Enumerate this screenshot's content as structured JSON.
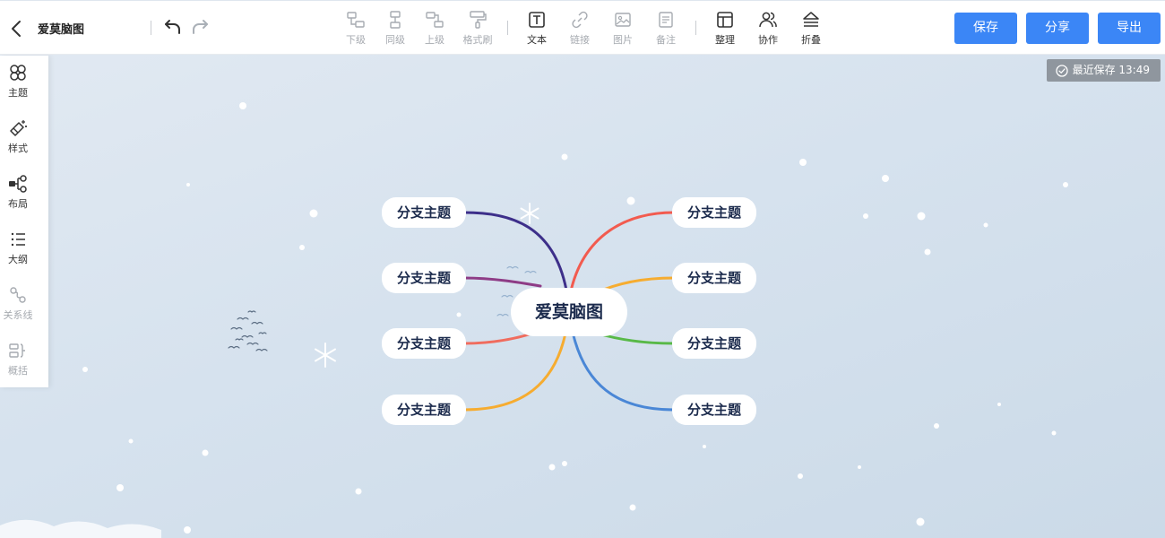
{
  "header": {
    "back_icon": "chevron-left-icon",
    "title": "爱莫脑图",
    "undo_icon": "undo-icon",
    "redo_icon": "redo-icon"
  },
  "toolbar": {
    "tools": [
      {
        "id": "child",
        "label": "下级",
        "icon": "add-child-node-icon",
        "enabled": false
      },
      {
        "id": "sibling",
        "label": "同级",
        "icon": "add-sibling-node-icon",
        "enabled": false
      },
      {
        "id": "parent",
        "label": "上级",
        "icon": "add-parent-node-icon",
        "enabled": false
      },
      {
        "id": "format-brush",
        "label": "格式刷",
        "icon": "format-brush-icon",
        "enabled": false
      },
      {
        "id": "text",
        "label": "文本",
        "icon": "text-box-icon",
        "enabled": true
      },
      {
        "id": "link",
        "label": "链接",
        "icon": "link-icon",
        "enabled": false
      },
      {
        "id": "image",
        "label": "图片",
        "icon": "image-icon",
        "enabled": false
      },
      {
        "id": "note",
        "label": "备注",
        "icon": "note-icon",
        "enabled": false
      },
      {
        "id": "arrange",
        "label": "整理",
        "icon": "layout-panel-icon",
        "enabled": true
      },
      {
        "id": "collab",
        "label": "协作",
        "icon": "users-icon",
        "enabled": true
      },
      {
        "id": "collapse",
        "label": "折叠",
        "icon": "collapse-icon",
        "enabled": true
      }
    ],
    "save_label": "保存",
    "share_label": "分享",
    "export_label": "导出",
    "accent_color": "#3b86f6"
  },
  "sidebar": {
    "items": [
      {
        "id": "theme",
        "label": "主题",
        "icon": "theme-grid-icon",
        "enabled": true
      },
      {
        "id": "style",
        "label": "样式",
        "icon": "magic-brush-icon",
        "enabled": true
      },
      {
        "id": "layout",
        "label": "布局",
        "icon": "layout-structure-icon",
        "enabled": true
      },
      {
        "id": "outline",
        "label": "大纲",
        "icon": "outline-list-icon",
        "enabled": true
      },
      {
        "id": "relation",
        "label": "关系线",
        "icon": "relation-line-icon",
        "enabled": false
      },
      {
        "id": "summary",
        "label": "概括",
        "icon": "summary-bracket-icon",
        "enabled": false
      }
    ]
  },
  "status": {
    "icon": "check-circle-icon",
    "text": "最近保存 13:49"
  },
  "mindmap": {
    "root": "爱莫脑图",
    "left_branches": [
      {
        "label": "分支主题",
        "color": "#3d2f8a"
      },
      {
        "label": "分支主题",
        "color": "#8e3c86"
      },
      {
        "label": "分支主题",
        "color": "#f06c5e"
      },
      {
        "label": "分支主题",
        "color": "#f6ac30"
      }
    ],
    "right_branches": [
      {
        "label": "分支主题",
        "color": "#f25b4f"
      },
      {
        "label": "分支主题",
        "color": "#f6ac30"
      },
      {
        "label": "分支主题",
        "color": "#58b947"
      },
      {
        "label": "分支主题",
        "color": "#4a87d6"
      }
    ]
  }
}
